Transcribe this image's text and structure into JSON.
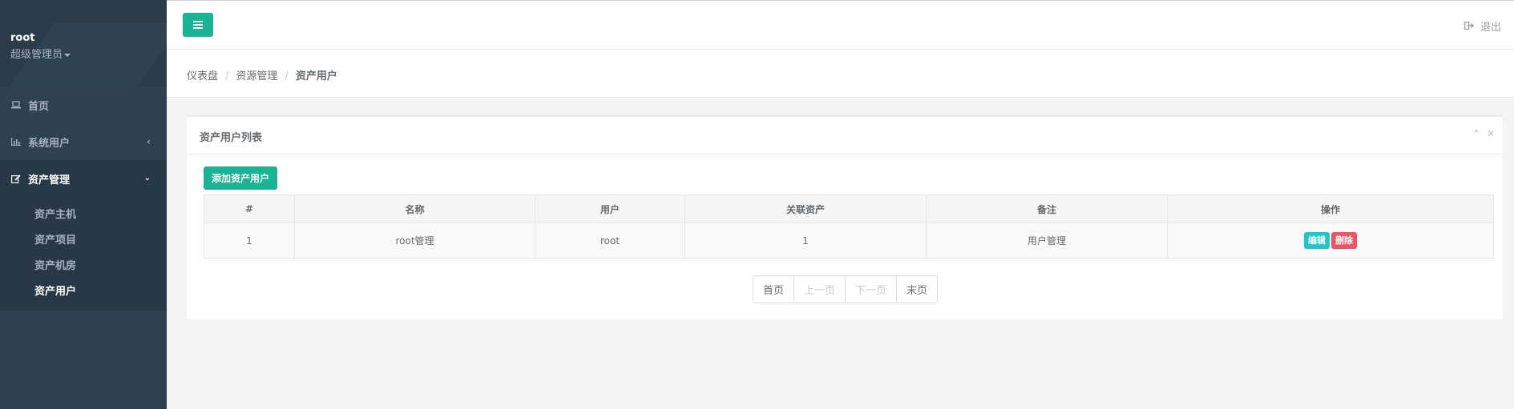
{
  "profile": {
    "username": "root",
    "role": "超级管理员"
  },
  "nav": {
    "items": [
      {
        "label": "首页",
        "icon": "laptop-icon"
      },
      {
        "label": "系统用户",
        "icon": "bar-chart-icon"
      },
      {
        "label": "资产管理",
        "icon": "edit-icon"
      }
    ],
    "submenu": [
      "资产主机",
      "资产项目",
      "资产机房",
      "资产用户"
    ]
  },
  "topbar": {
    "logout_label": "退出"
  },
  "breadcrumb": [
    "仪表盘",
    "资源管理",
    "资产用户"
  ],
  "panel": {
    "title": "资产用户列表",
    "add_button": "添加资产用户"
  },
  "table": {
    "headers": [
      "#",
      "名称",
      "用户",
      "关联资产",
      "备注",
      "操作"
    ],
    "rows": [
      {
        "id": "1",
        "name": "root管理",
        "user": "root",
        "assets": "1",
        "note": "用户管理",
        "edit": "编辑",
        "delete": "删除"
      }
    ]
  },
  "pagination": {
    "first": "首页",
    "prev": "上一页",
    "next": "下一页",
    "last": "末页"
  },
  "colors": {
    "primary": "#1ab394",
    "sidebar": "#2f4050",
    "info": "#23c6c8",
    "danger": "#ed5565"
  }
}
